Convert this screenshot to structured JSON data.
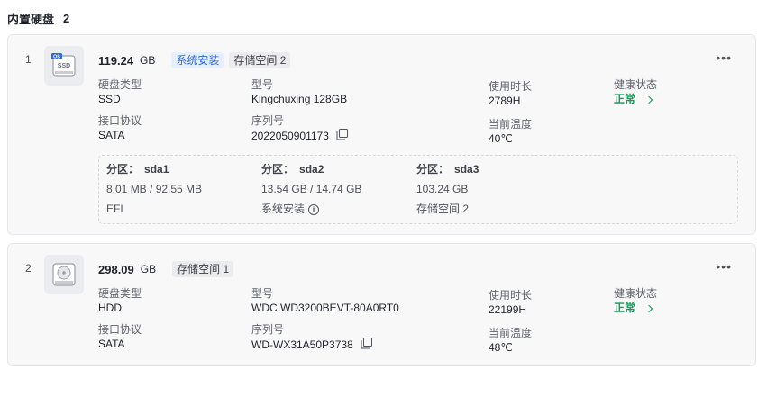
{
  "section": {
    "title": "内置硬盘",
    "count": "2"
  },
  "labels": {
    "disk_type": "硬盘类型",
    "model": "型号",
    "uptime": "使用时长",
    "health": "健康状态",
    "interface": "接口协议",
    "serial": "序列号",
    "temperature": "当前温度",
    "partition": "分区："
  },
  "disks": [
    {
      "index": "1",
      "icon": "ssd-os-disk-icon",
      "icon_badge": "OS",
      "icon_text": "SSD",
      "capacity": "119.24",
      "unit": "GB",
      "tags": [
        "系统安装",
        "存储空间 2"
      ],
      "disk_type": "SSD",
      "model": "Kingchuxing 128GB",
      "uptime": "2789H",
      "health": "正常",
      "interface": "SATA",
      "serial": "2022050901173",
      "temperature": "40℃",
      "partitions": [
        {
          "name": "sda1",
          "size": "8.01 MB / 92.55 MB",
          "usage": "EFI"
        },
        {
          "name": "sda2",
          "size": "13.54 GB / 14.74 GB",
          "usage": "系统安装"
        },
        {
          "name": "sda3",
          "size": "103.24 GB",
          "usage": "存储空间 2"
        }
      ]
    },
    {
      "index": "2",
      "icon": "hdd-disk-icon",
      "capacity": "298.09",
      "unit": "GB",
      "tags": [
        "存储空间 1"
      ],
      "disk_type": "HDD",
      "model": "WDC WD3200BEVT-80A0RT0",
      "uptime": "22199H",
      "health": "正常",
      "interface": "SATA",
      "serial": "WD-WX31A50P3738",
      "temperature": "48℃"
    }
  ],
  "colors": {
    "accent_blue": "#2d6ad6",
    "health_green": "#14995a",
    "card_bg": "#f8f8f9"
  }
}
